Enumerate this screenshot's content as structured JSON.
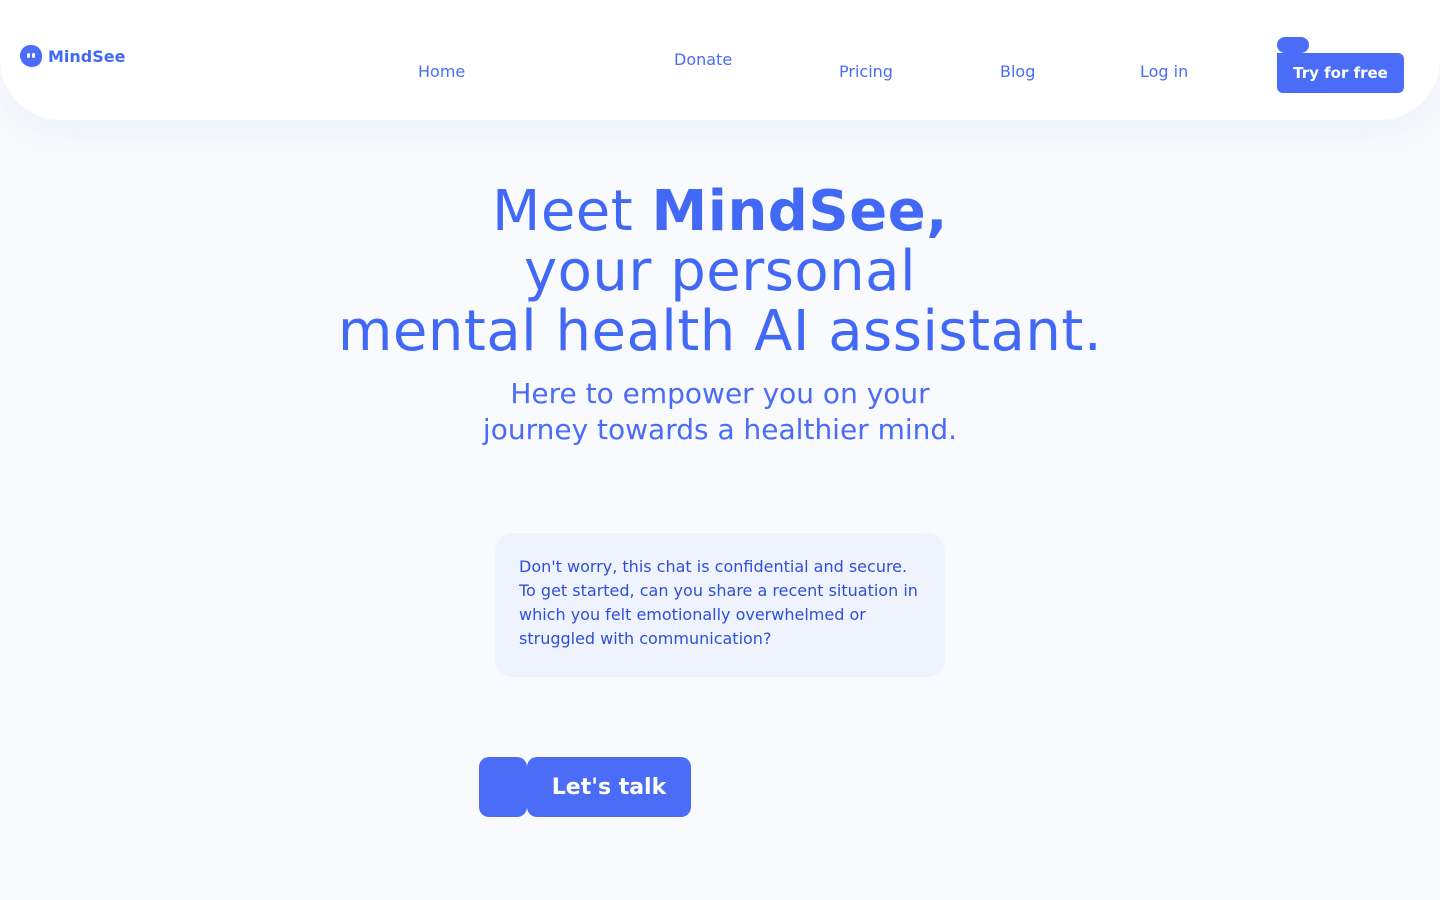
{
  "brand": {
    "name": "MindSee",
    "logo_icon": "mindsee-face-icon",
    "color": "#4a6cf7"
  },
  "nav": {
    "items": [
      "Home",
      "Donate",
      "Pricing",
      "Blog",
      "Log in"
    ],
    "cta_label": "Try for free"
  },
  "hero": {
    "title_prefix": "Meet ",
    "title_brand": "MindSee,",
    "title_line2": "your personal",
    "title_line3": "mental health AI assistant.",
    "subtitle_line1": "Here to empower you on your",
    "subtitle_line2": "journey towards a healthier mind."
  },
  "chat": {
    "message": "Don't worry, this chat is confidential and secure. To get started, can you share a recent situation in which you felt emotionally overwhelmed or struggled with communication?"
  },
  "actions": {
    "talk_label": "Let's talk"
  },
  "colors": {
    "primary": "#4a6cf7",
    "background": "#f9fafd",
    "card": "#eff3fd"
  }
}
